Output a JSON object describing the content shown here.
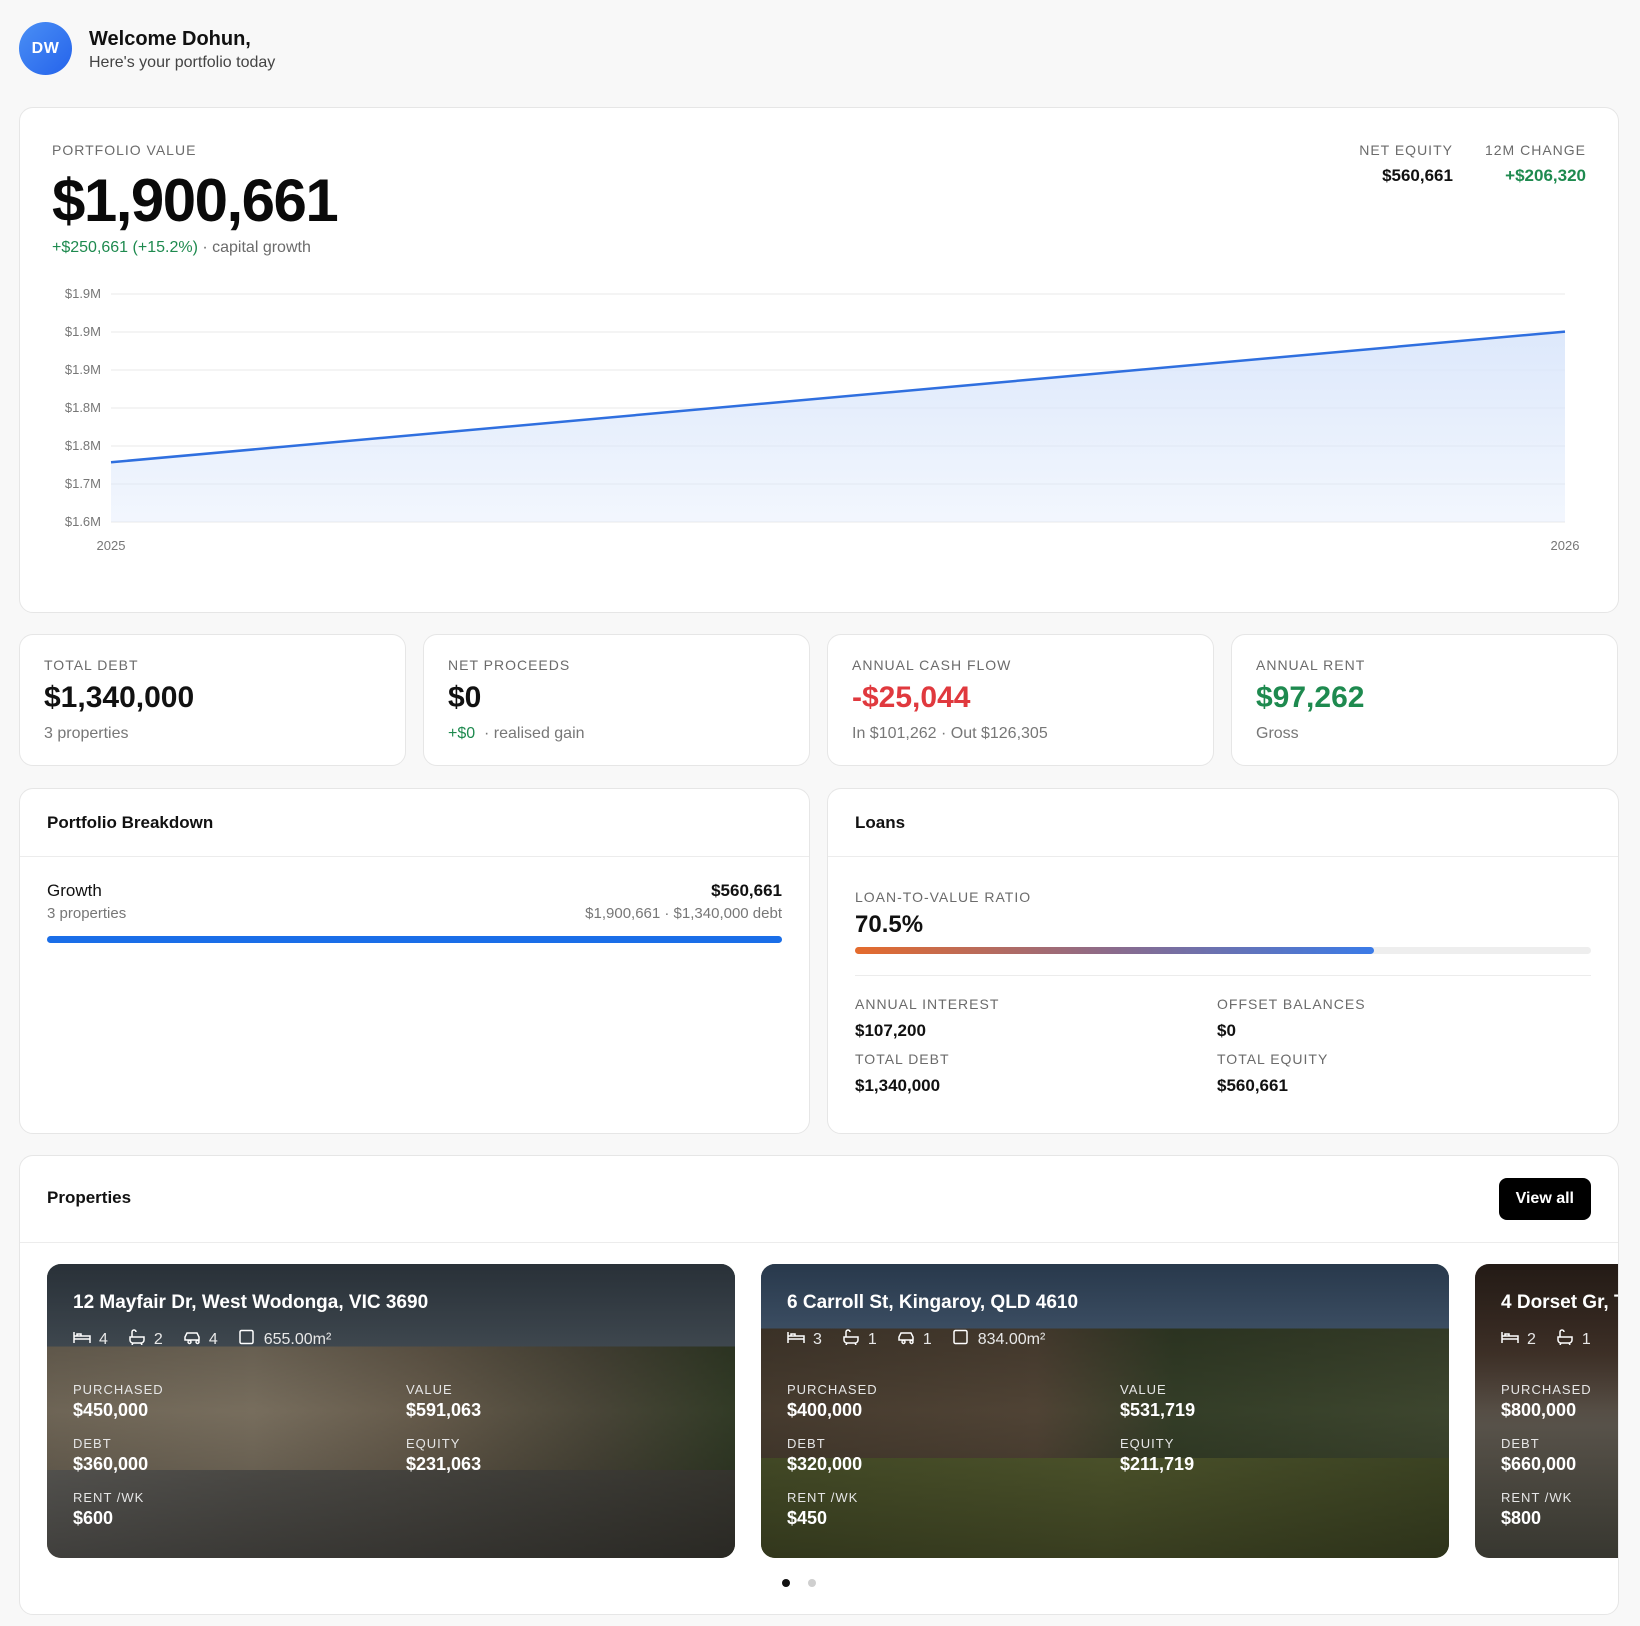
{
  "header": {
    "initials": "DW",
    "welcome": "Welcome Dohun,",
    "subtitle": "Here's your portfolio today"
  },
  "portfolio": {
    "label": "PORTFOLIO VALUE",
    "value": "$1,900,661",
    "growth_amount": "+$250,661",
    "growth_pct": "(+15.2%)",
    "growth_suffix": "· capital growth",
    "net_equity_label": "NET EQUITY",
    "net_equity": "$560,661",
    "change_label": "12M CHANGE",
    "change": "+$206,320"
  },
  "chart_data": {
    "type": "area",
    "x": [
      "2025",
      "2026"
    ],
    "values": [
      1694341,
      1900661
    ],
    "y_tick_labels": [
      "$1.9M",
      "$1.9M",
      "$1.9M",
      "$1.8M",
      "$1.8M",
      "$1.7M",
      "$1.6M"
    ],
    "ylim": [
      1600000,
      1960000
    ],
    "grid": true,
    "colors": {
      "line": "#2f6fdf",
      "fill": "#dbe7fb"
    }
  },
  "metrics": [
    {
      "label": "TOTAL DEBT",
      "value": "$1,340,000",
      "sub": "3 properties",
      "color": "#111111"
    },
    {
      "label": "NET PROCEEDS",
      "value": "$0",
      "sub_accent": "+$0",
      "sub": "· realised gain",
      "color": "#111111"
    },
    {
      "label": "ANNUAL CASH FLOW",
      "value": "-$25,044",
      "sub": "In $101,262 · Out $126,305",
      "color": "#e0393e"
    },
    {
      "label": "ANNUAL RENT",
      "value": "$97,262",
      "sub": "Gross",
      "color": "#1e8a4f"
    }
  ],
  "breakdown": {
    "title": "Portfolio Breakdown",
    "row": {
      "name": "Growth",
      "count": "3 properties",
      "amount": "$560,661",
      "detail": "$1,900,661 · $1,340,000 debt",
      "fill_fraction": 1.0
    }
  },
  "loans": {
    "title": "Loans",
    "ltv_label": "LOAN-TO-VALUE RATIO",
    "ltv_value": "70.5%",
    "ltv_fraction": 0.705,
    "stats": [
      {
        "label": "ANNUAL INTEREST",
        "value": "$107,200"
      },
      {
        "label": "OFFSET BALANCES",
        "value": "$0"
      },
      {
        "label": "TOTAL DEBT",
        "value": "$1,340,000"
      },
      {
        "label": "TOTAL EQUITY",
        "value": "$560,661"
      }
    ]
  },
  "properties": {
    "title": "Properties",
    "view_all": "View all",
    "stat_labels": {
      "purchased": "PURCHASED",
      "value": "VALUE",
      "debt": "DEBT",
      "equity": "EQUITY",
      "rent": "RENT /WK"
    },
    "items": [
      {
        "address": "12 Mayfair Dr, West Wodonga, VIC 3690",
        "beds": "4",
        "baths": "2",
        "cars": "4",
        "area": "655.00m²",
        "purchased": "$450,000",
        "value": "$591,063",
        "debt": "$360,000",
        "equity": "$231,063",
        "rent": "$600"
      },
      {
        "address": "6 Carroll St, Kingaroy, QLD 4610",
        "beds": "3",
        "baths": "1",
        "cars": "1",
        "area": "834.00m²",
        "purchased": "$400,000",
        "value": "$531,719",
        "debt": "$320,000",
        "equity": "$211,719",
        "rent": "$450"
      },
      {
        "address": "4 Dorset Gr, T",
        "beds": "2",
        "baths": "1",
        "cars": "",
        "area": "",
        "purchased": "$800,000",
        "value": "",
        "debt": "$660,000",
        "equity": "",
        "rent": "$800"
      }
    ]
  }
}
